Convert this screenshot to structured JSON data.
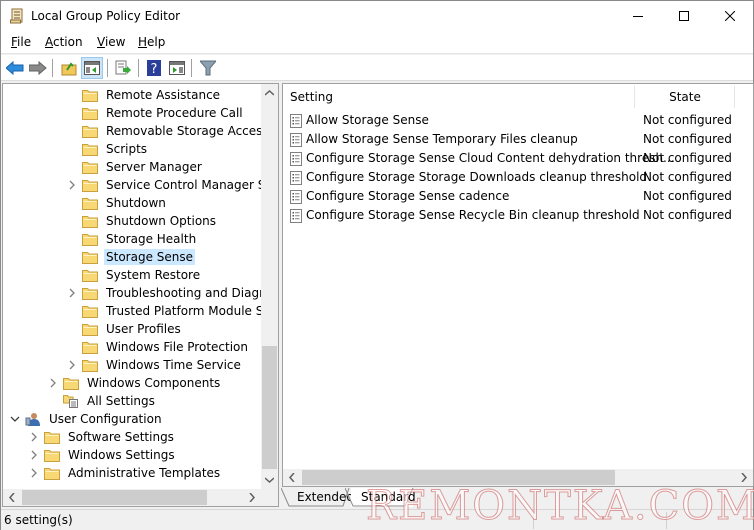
{
  "window": {
    "title": "Local Group Policy Editor",
    "app_icon": "scroll-icon",
    "controls": [
      "minimize",
      "maximize",
      "close"
    ]
  },
  "menu": {
    "items": [
      {
        "label": "File",
        "accel": "F"
      },
      {
        "label": "Action",
        "accel": "A"
      },
      {
        "label": "View",
        "accel": "V"
      },
      {
        "label": "Help",
        "accel": "H"
      }
    ]
  },
  "toolbar": {
    "buttons": [
      {
        "icon": "back-arrow-icon",
        "label": "Back"
      },
      {
        "icon": "forward-arrow-icon",
        "label": "Forward"
      },
      {
        "icon": "up-folder-icon",
        "label": "Up one level"
      },
      {
        "icon": "show-hide-console-tree-icon",
        "label": "Show/Hide Console Tree",
        "active": true
      },
      {
        "icon": "export-list-icon",
        "label": "Export List"
      },
      {
        "icon": "help-icon",
        "label": "Help"
      },
      {
        "icon": "show-hide-action-pane-icon",
        "label": "Show/Hide Action Pane"
      },
      {
        "icon": "filter-icon",
        "label": "Filter Options"
      }
    ]
  },
  "tree": {
    "items": [
      {
        "label": "Remote Assistance",
        "level": 3,
        "expandable": false
      },
      {
        "label": "Remote Procedure Call",
        "level": 3,
        "expandable": false
      },
      {
        "label": "Removable Storage Access",
        "level": 3,
        "expandable": false
      },
      {
        "label": "Scripts",
        "level": 3,
        "expandable": false
      },
      {
        "label": "Server Manager",
        "level": 3,
        "expandable": false
      },
      {
        "label": "Service Control Manager Setti",
        "level": 3,
        "expandable": true
      },
      {
        "label": "Shutdown",
        "level": 3,
        "expandable": false
      },
      {
        "label": "Shutdown Options",
        "level": 3,
        "expandable": false
      },
      {
        "label": "Storage Health",
        "level": 3,
        "expandable": false
      },
      {
        "label": "Storage Sense",
        "level": 3,
        "expandable": false,
        "selected": true
      },
      {
        "label": "System Restore",
        "level": 3,
        "expandable": false
      },
      {
        "label": "Troubleshooting and Diagnost",
        "level": 3,
        "expandable": true
      },
      {
        "label": "Trusted Platform Module Serv",
        "level": 3,
        "expandable": false
      },
      {
        "label": "User Profiles",
        "level": 3,
        "expandable": false
      },
      {
        "label": "Windows File Protection",
        "level": 3,
        "expandable": false
      },
      {
        "label": "Windows Time Service",
        "level": 3,
        "expandable": true
      },
      {
        "label": "Windows Components",
        "level": 2,
        "expandable": true
      },
      {
        "label": "All Settings",
        "level": 2,
        "expandable": false,
        "icon": "all-settings-icon"
      },
      {
        "label": "User Configuration",
        "level": 0,
        "expandable": true,
        "expanded": true,
        "icon": "user-config-icon"
      },
      {
        "label": "Software Settings",
        "level": 1,
        "expandable": true
      },
      {
        "label": "Windows Settings",
        "level": 1,
        "expandable": true
      },
      {
        "label": "Administrative Templates",
        "level": 1,
        "expandable": true
      }
    ]
  },
  "list": {
    "columns": [
      "Setting",
      "State"
    ],
    "rows": [
      {
        "setting": "Allow Storage Sense",
        "state": "Not configured"
      },
      {
        "setting": "Allow Storage Sense Temporary Files cleanup",
        "state": "Not configured"
      },
      {
        "setting": "Configure Storage Sense Cloud Content dehydration thresh...",
        "state": "Not configured"
      },
      {
        "setting": "Configure Storage Storage Downloads cleanup threshold",
        "state": "Not configured"
      },
      {
        "setting": "Configure Storage Sense cadence",
        "state": "Not configured"
      },
      {
        "setting": "Configure Storage Sense Recycle Bin cleanup threshold",
        "state": "Not configured"
      }
    ]
  },
  "tabs": [
    {
      "label": "Extended",
      "active": false
    },
    {
      "label": "Standard",
      "active": true
    }
  ],
  "status": {
    "text": "6 setting(s)"
  },
  "watermark": "REMONTKA.COM",
  "colors": {
    "selection": "#cce8ff",
    "toolbar_active": "#cce4f7",
    "folder": "#f8d775"
  }
}
